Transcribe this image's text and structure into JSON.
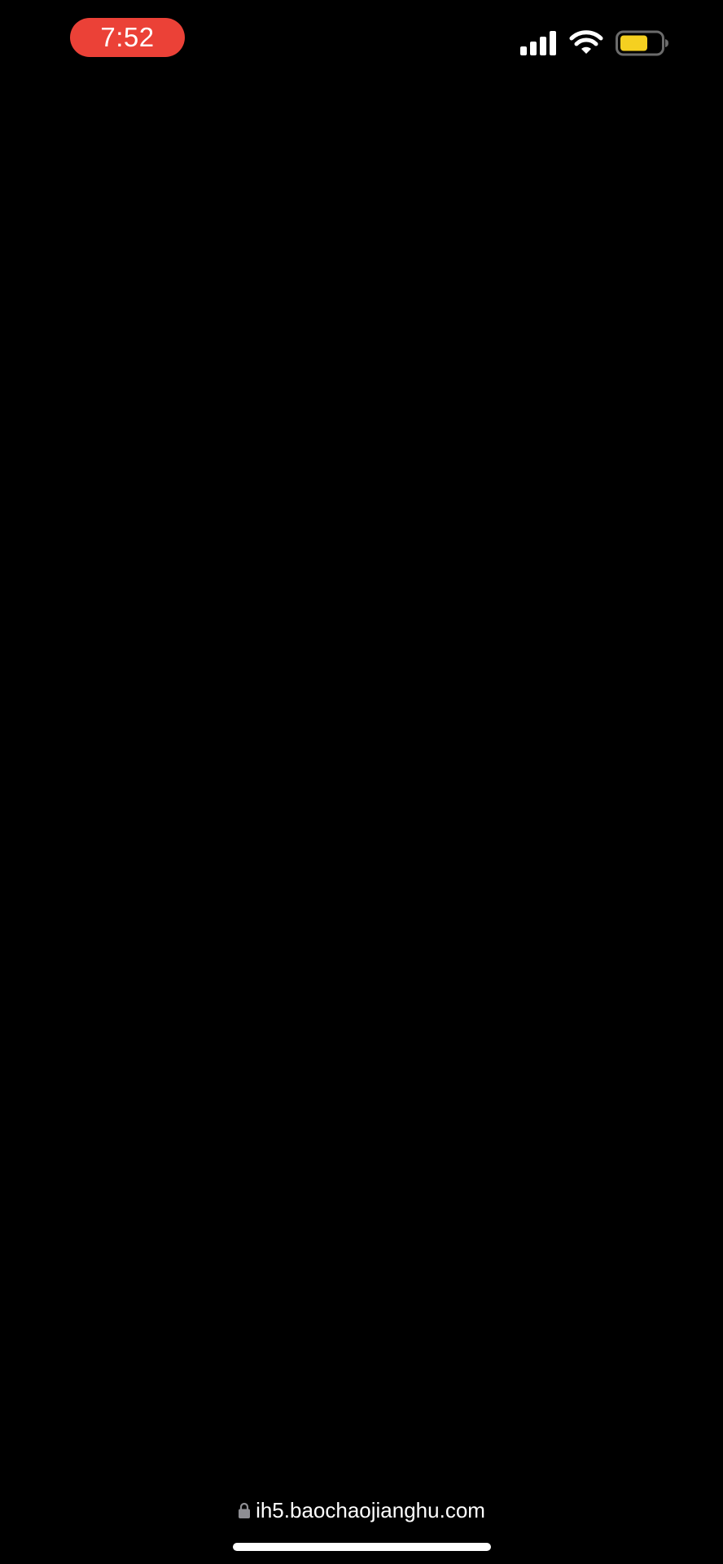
{
  "status_bar": {
    "time": "7:52",
    "time_pill_color": "#eb4137",
    "battery_color": "#f5d020",
    "icons": [
      "signal-icon",
      "wifi-icon",
      "battery-icon"
    ]
  },
  "address_bar": {
    "lock_icon": "lock-icon",
    "url": "ih5.baochaojianghu.com"
  }
}
